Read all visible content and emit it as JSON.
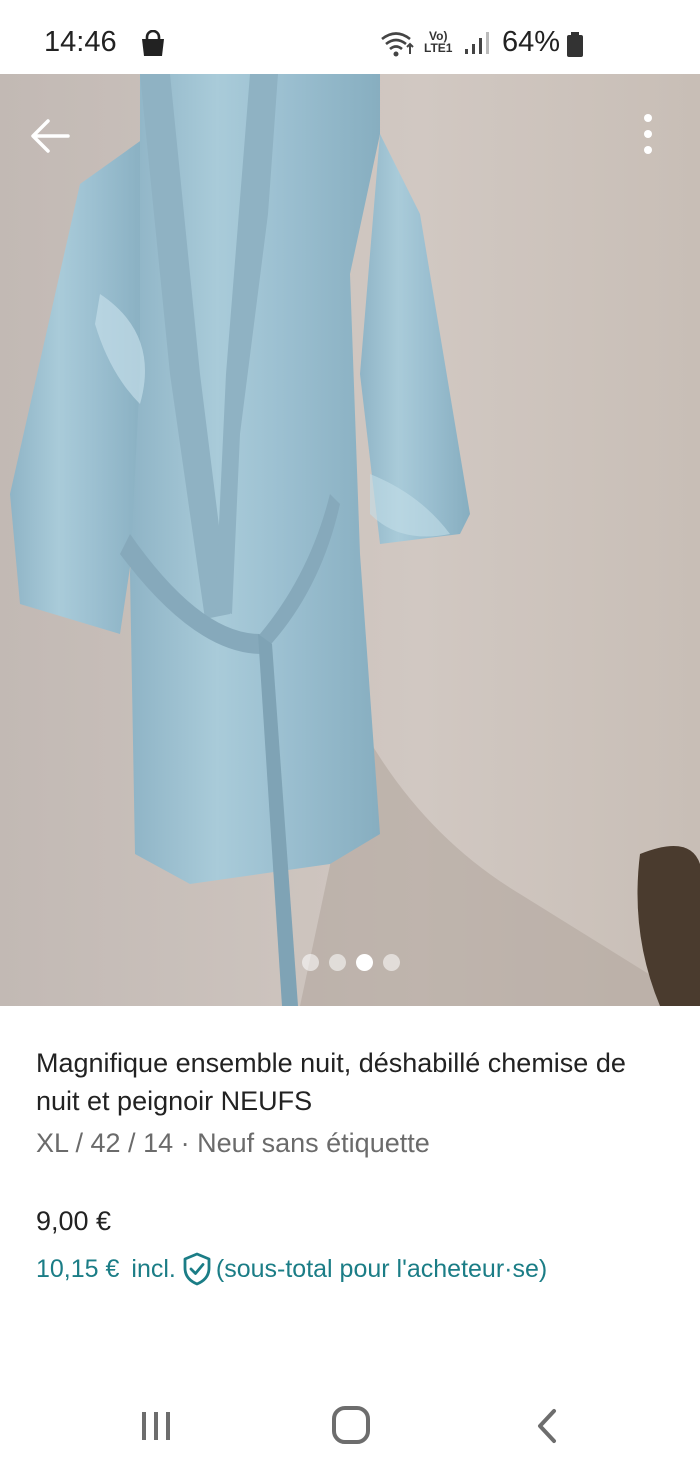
{
  "status_bar": {
    "time": "14:46",
    "network_label_top": "Vo)",
    "network_label_bottom": "LTE1",
    "battery": "64%"
  },
  "gallery": {
    "image_description": "light blue satin robe hanging on a wall",
    "image_count": 4,
    "active_index": 2
  },
  "listing": {
    "title": "Magnifique ensemble nuit, déshabillé chemise de nuit et peignoir NEUFS",
    "subtitle": "XL / 42 / 14 · Neuf sans étiquette",
    "price": "9,00 €",
    "price_incl_amount": "10,15 €",
    "price_incl_label": "incl.",
    "price_incl_note": "(sous-total pour l'acheteur·se)"
  },
  "colors": {
    "accent": "#1b7d86",
    "text_primary": "#222222",
    "text_secondary": "#6b6b6b"
  }
}
